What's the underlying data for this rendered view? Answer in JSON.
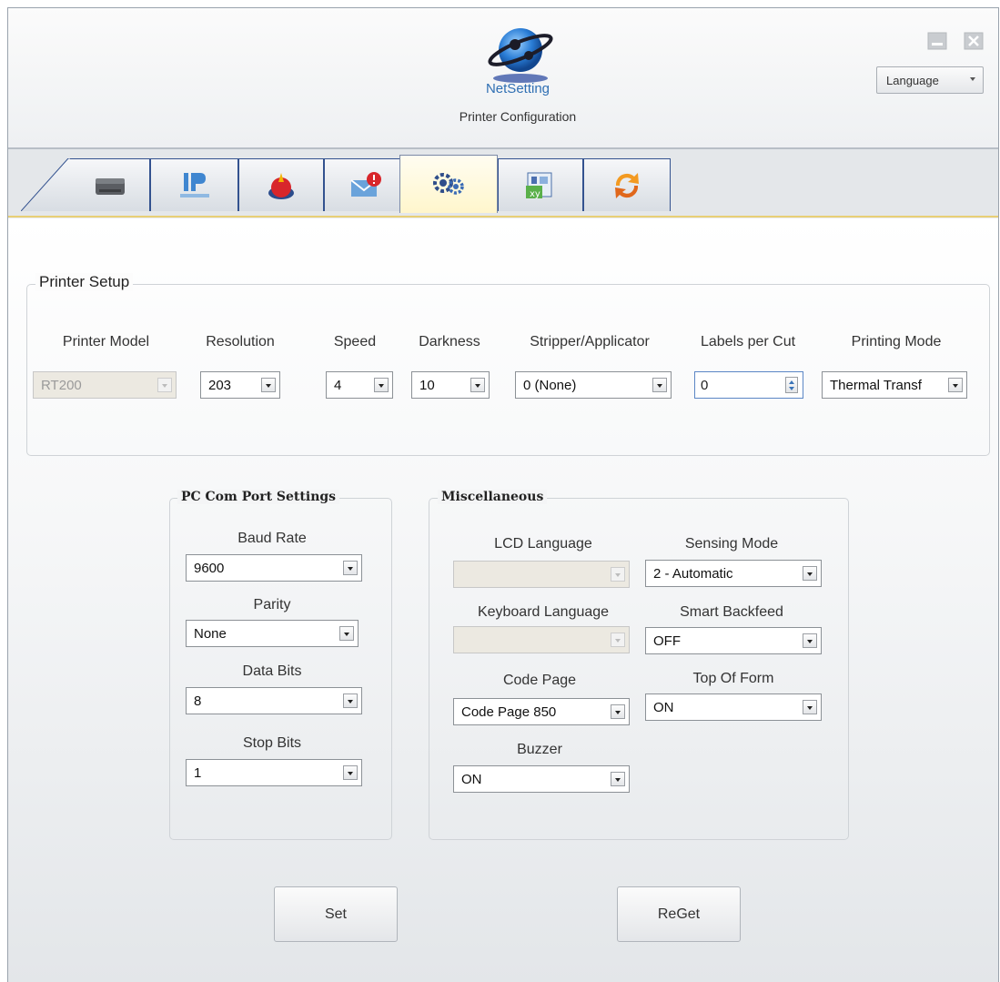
{
  "header": {
    "app_name": "NetSetting",
    "subtitle": "Printer Configuration",
    "language_label": "Language"
  },
  "tabs": [
    {
      "icon": "printer-icon"
    },
    {
      "icon": "network-icon"
    },
    {
      "icon": "alert-light-icon"
    },
    {
      "icon": "mail-alert-icon"
    },
    {
      "icon": "gears-icon",
      "active": true
    },
    {
      "icon": "xy-chart-icon"
    },
    {
      "icon": "refresh-icon"
    }
  ],
  "printer_setup": {
    "legend": "Printer Setup",
    "printer_model": {
      "label": "Printer Model",
      "value": "RT200"
    },
    "resolution": {
      "label": "Resolution",
      "value": "203"
    },
    "speed": {
      "label": "Speed",
      "value": "4"
    },
    "darkness": {
      "label": "Darkness",
      "value": "10"
    },
    "stripper": {
      "label": "Stripper/Applicator",
      "value": "0 (None)"
    },
    "labels_per_cut": {
      "label": "Labels per Cut",
      "value": "0"
    },
    "printing_mode": {
      "label": "Printing Mode",
      "value": "Thermal Transf"
    }
  },
  "com_port": {
    "legend": "PC Com Port Settings",
    "baud_rate": {
      "label": "Baud Rate",
      "value": "9600"
    },
    "parity": {
      "label": "Parity",
      "value": "None"
    },
    "data_bits": {
      "label": "Data Bits",
      "value": "8"
    },
    "stop_bits": {
      "label": "Stop Bits",
      "value": "1"
    }
  },
  "misc": {
    "legend": "Miscellaneous",
    "lcd_language": {
      "label": "LCD Language",
      "value": ""
    },
    "keyboard_language": {
      "label": "Keyboard Language",
      "value": ""
    },
    "code_page": {
      "label": "Code Page",
      "value": "Code Page 850"
    },
    "buzzer": {
      "label": "Buzzer",
      "value": "ON"
    },
    "sensing_mode": {
      "label": "Sensing Mode",
      "value": "2 - Automatic"
    },
    "smart_backfeed": {
      "label": "Smart Backfeed",
      "value": "OFF"
    },
    "top_of_form": {
      "label": "Top Of Form",
      "value": "ON"
    }
  },
  "buttons": {
    "set": "Set",
    "reget": "ReGet"
  }
}
